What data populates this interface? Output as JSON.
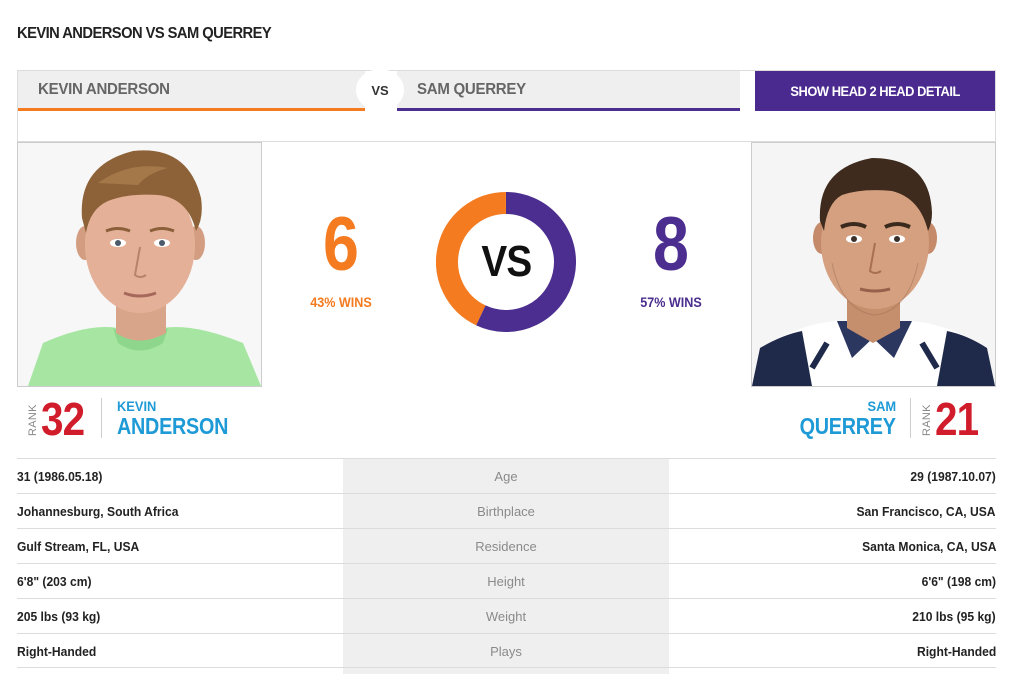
{
  "page_title": "KEVIN ANDERSON VS SAM QUERREY",
  "header": {
    "left_name": "KEVIN ANDERSON",
    "vs_label": "VS",
    "right_name": "SAM QUERREY",
    "detail_button": "SHOW HEAD 2 HEAD DETAIL"
  },
  "colors": {
    "left_accent": "#f47b20",
    "right_accent": "#4b2e8f",
    "rank_red": "#d11d2b",
    "name_blue": "#1e9ad6"
  },
  "head2head": {
    "left_wins": "6",
    "left_pct": "43% WINS",
    "right_wins": "8",
    "right_pct": "57% WINS",
    "center_label": "VS",
    "left_share": 0.43,
    "right_share": 0.57
  },
  "left_player": {
    "rank_word": "RANK",
    "rank": "32",
    "first_name": "KEVIN",
    "last_name": "ANDERSON",
    "photo": "player-photo"
  },
  "right_player": {
    "rank_word": "RANK",
    "rank": "21",
    "first_name": "SAM",
    "last_name": "QUERREY",
    "photo": "player-photo"
  },
  "stats": [
    {
      "label": "Age",
      "left": "31 (1986.05.18)",
      "right": "29 (1987.10.07)"
    },
    {
      "label": "Birthplace",
      "left": "Johannesburg, South Africa",
      "right": "San Francisco, CA, USA"
    },
    {
      "label": "Residence",
      "left": "Gulf Stream, FL, USA",
      "right": "Santa Monica, CA, USA"
    },
    {
      "label": "Height",
      "left": "6'8\" (203 cm)",
      "right": "6'6\" (198 cm)"
    },
    {
      "label": "Weight",
      "left": "205 lbs (93 kg)",
      "right": "210 lbs (95 kg)"
    },
    {
      "label": "Plays",
      "left": "Right-Handed",
      "right": "Right-Handed"
    }
  ]
}
